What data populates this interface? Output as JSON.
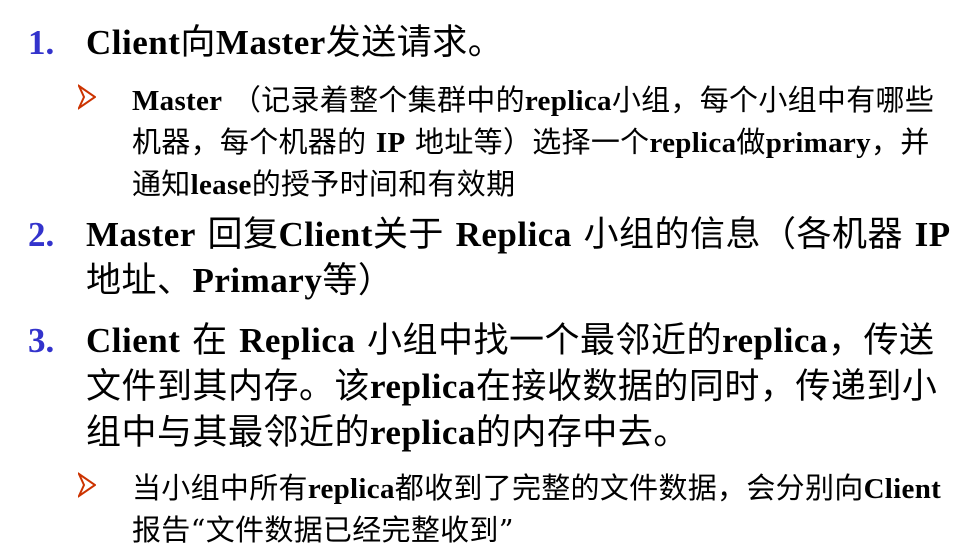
{
  "colors": {
    "number": "#3333cc",
    "arrow": "#cc3300",
    "text": "#000000",
    "background": "#ffffff"
  },
  "items": [
    {
      "number": "1.",
      "text": "Client向Master发送请求。",
      "subs": [
        {
          "marker": "arrow-bullet-icon",
          "text": "Master （记录着整个集群中的replica小组，每个小组中有哪些机器，每个机器的 IP 地址等）选择一个replica做primary，并通知lease的授予时间和有效期"
        }
      ]
    },
    {
      "number": "2.",
      "text": "Master 回复Client关于 Replica 小组的信息（各机器 IP 地址、Primary等）"
    },
    {
      "number": "3.",
      "text": "Client 在 Replica 小组中找一个最邻近的replica，传送文件到其内存。该replica在接收数据的同时，传递到小组中与其最邻近的replica的内存中去。",
      "subs": [
        {
          "marker": "arrow-bullet-icon",
          "text": "当小组中所有replica都收到了完整的文件数据，会分别向Client报告“文件数据已经完整收到”"
        }
      ]
    }
  ]
}
